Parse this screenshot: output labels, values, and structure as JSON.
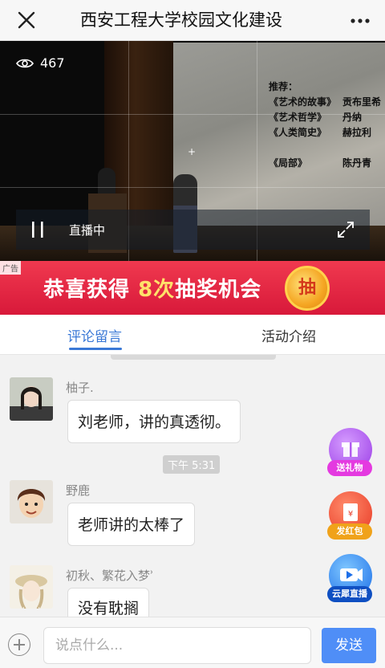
{
  "header": {
    "title": "西安工程大学校园文化建设",
    "close_icon": "close-icon",
    "more_icon": "more-icon"
  },
  "video": {
    "viewer_count": "467",
    "status_label": "直播中",
    "slide": {
      "heading": "推荐：",
      "rows": [
        {
          "book": "《艺术的故事》",
          "author": "贡布里希"
        },
        {
          "book": "《艺术哲学》",
          "author": "丹纳"
        },
        {
          "book": "《人类简史》",
          "author": "赫拉利"
        },
        {
          "book": "",
          "author": ""
        },
        {
          "book": "《局部》",
          "author": "陈丹青"
        }
      ]
    }
  },
  "ad": {
    "tag": "广告",
    "text_before": "恭喜获得 ",
    "text_highlight": "8次",
    "text_after": "抽奖机会",
    "coin_label": "抽"
  },
  "tabs": [
    {
      "label": "评论留言",
      "active": true
    },
    {
      "label": "活动介绍",
      "active": false
    }
  ],
  "messages": [
    {
      "user": "柚子.",
      "text": "刘老师，讲的真透彻。"
    },
    {
      "user": "野鹿",
      "text": "老师讲的太棒了"
    },
    {
      "user": "初秋、繁花入梦ʾ",
      "text": "没有耽搁"
    }
  ],
  "time_divider": "下午 5:31",
  "floating": [
    {
      "label": "送礼物",
      "icon": "gift-icon",
      "color": "#a84ef0"
    },
    {
      "label": "发红包",
      "icon": "red-envelope-icon",
      "color": "#f2553a"
    },
    {
      "label": "云犀直播",
      "icon": "live-video-icon",
      "color": "#2b7cf2"
    }
  ],
  "input": {
    "placeholder": "说点什么...",
    "send_label": "发送"
  }
}
